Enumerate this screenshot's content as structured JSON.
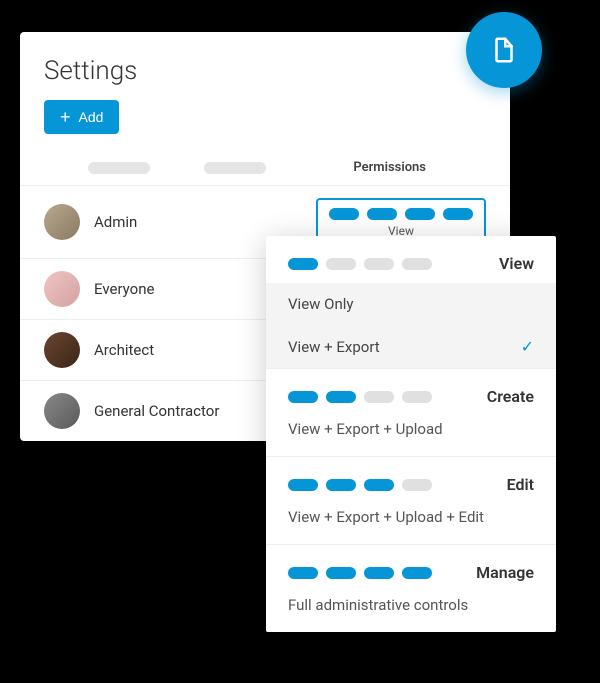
{
  "header": {
    "title": "Settings",
    "add_label": "Add"
  },
  "table": {
    "permissions_col": "Permissions"
  },
  "roles": [
    {
      "name": "Admin"
    },
    {
      "name": "Everyone"
    },
    {
      "name": "Architect"
    },
    {
      "name": "General Contractor"
    }
  ],
  "selected_permission": {
    "label": "View"
  },
  "dropdown": {
    "view": {
      "title": "View",
      "option_view_only": "View Only",
      "option_view_export": "View + Export"
    },
    "create": {
      "title": "Create",
      "desc": "View + Export + Upload"
    },
    "edit": {
      "title": "Edit",
      "desc": "View + Export + Upload + Edit"
    },
    "manage": {
      "title": "Manage",
      "desc": "Full administrative controls"
    }
  }
}
